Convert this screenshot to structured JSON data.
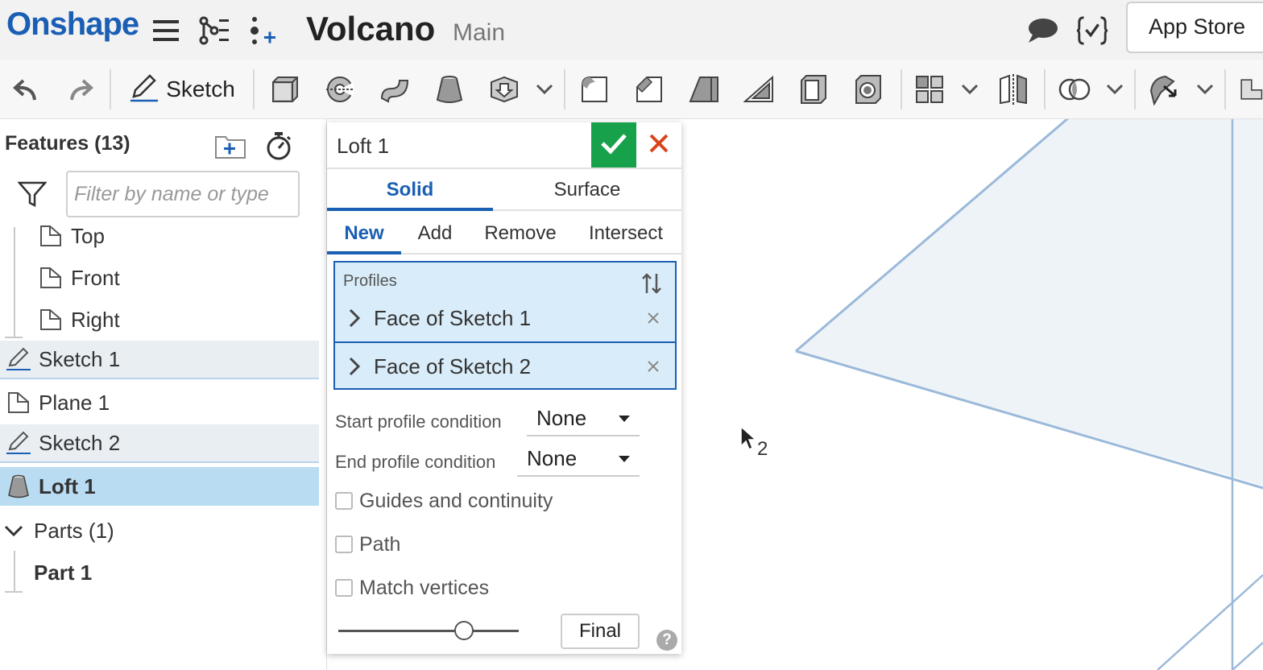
{
  "header": {
    "logo": "Onshape",
    "doc_title": "Volcano",
    "branch": "Main",
    "app_store": "App Store",
    "icons": [
      "menu-icon",
      "versions-icon",
      "insert-feature-icon",
      "comment-icon",
      "featurescript-icon"
    ]
  },
  "toolbar": {
    "sketch_label": "Sketch",
    "tools": [
      "undo-icon",
      "redo-icon",
      "sketch-icon",
      "extrude-icon",
      "revolve-icon",
      "sweep-icon",
      "loft-icon",
      "thicken-icon",
      "fillet-icon",
      "chamfer-icon",
      "draft-icon",
      "rib-icon",
      "shell-icon",
      "hole-icon",
      "pattern-icon",
      "mirror-icon",
      "boolean-icon",
      "transform-icon",
      "plane-icon"
    ]
  },
  "features": {
    "title": "Features (13)",
    "filter_placeholder": "Filter by name or type",
    "items": [
      {
        "label": "Top",
        "type": "plane"
      },
      {
        "label": "Front",
        "type": "plane"
      },
      {
        "label": "Right",
        "type": "plane"
      },
      {
        "label": "Sketch 1",
        "type": "sketch"
      },
      {
        "label": "Plane 1",
        "type": "plane"
      },
      {
        "label": "Sketch 2",
        "type": "sketch"
      },
      {
        "label": "Loft 1",
        "type": "loft"
      }
    ],
    "parts_header": "Parts (1)",
    "parts": [
      {
        "label": "Part 1"
      }
    ]
  },
  "loft_dialog": {
    "title": "Loft 1",
    "body_tabs": [
      {
        "label": "Solid",
        "active": true
      },
      {
        "label": "Surface",
        "active": false
      }
    ],
    "operation_tabs": [
      {
        "label": "New",
        "active": true
      },
      {
        "label": "Add",
        "active": false
      },
      {
        "label": "Remove",
        "active": false
      },
      {
        "label": "Intersect",
        "active": false
      }
    ],
    "profiles_label": "Profiles",
    "profiles": [
      {
        "label": "Face of Sketch 1"
      },
      {
        "label": "Face of Sketch 2"
      }
    ],
    "start_condition_label": "Start profile condition",
    "start_condition_value": "None",
    "end_condition_label": "End profile condition",
    "end_condition_value": "None",
    "options": [
      {
        "label": "Guides and continuity",
        "checked": false
      },
      {
        "label": "Path",
        "checked": false
      },
      {
        "label": "Match vertices",
        "checked": false
      }
    ],
    "final_label": "Final",
    "help": "?",
    "slider_value": 0.7
  },
  "viewport": {
    "cursor_count": "2"
  },
  "colors": {
    "brand": "#1a5fb4",
    "confirm": "#17a14a",
    "cancel": "#d9441c",
    "selection": "#b9dcf3"
  }
}
